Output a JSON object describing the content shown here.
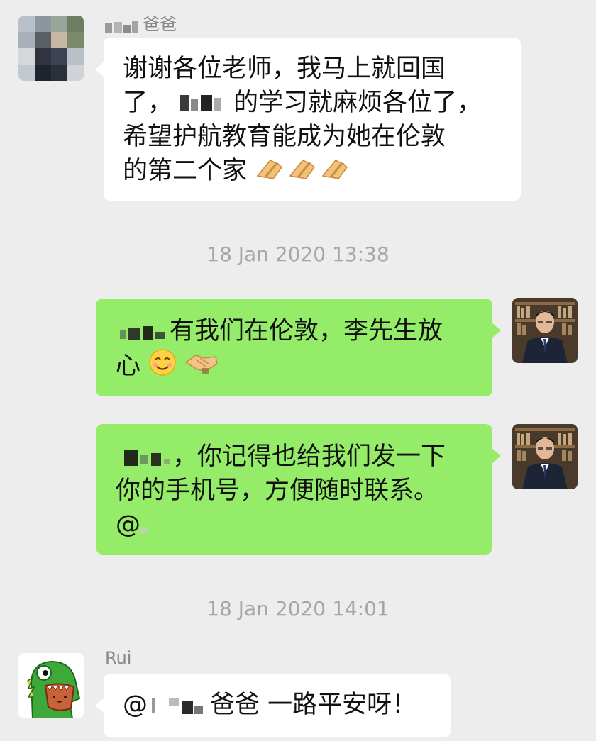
{
  "messages": {
    "m1": {
      "sender": "爸爸",
      "line1": "谢谢各位老师，我马上就回国",
      "line2a": "了，",
      "line2b": "的学习就麻烦各位了，",
      "line3": "希望护航教育能成为她在伦敦",
      "line4": "的第二个家"
    },
    "m2": {
      "line1": "有我们在伦敦，李先生放",
      "line2": "心"
    },
    "m3": {
      "line1": "，你记得也给我们发一下",
      "line2": "你的手机号，方便随时联系。",
      "line3": "@"
    },
    "m4": {
      "sender": "Rui",
      "text_at": "@",
      "text_main": "爸爸 一路平安呀！"
    }
  },
  "timestamps": {
    "t1": "18 Jan 2020 13:38",
    "t2": "18 Jan 2020 14:01"
  },
  "colors": {
    "background": "#ededed",
    "bubble_received": "#ffffff",
    "bubble_sent": "#95ec69",
    "timestamp_text": "#a6a6a6"
  },
  "icons": [
    "pixelated-avatar-icon",
    "advisor-avatar-icon",
    "dinosaur-avatar-icon",
    "praying-hands-icon",
    "smiling-face-icon",
    "handshake-icon"
  ]
}
